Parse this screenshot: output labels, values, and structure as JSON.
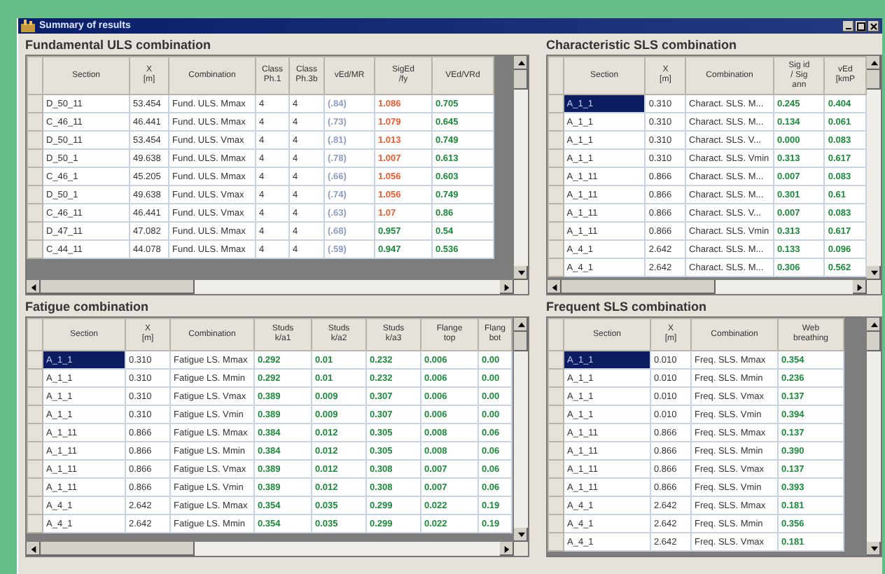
{
  "window": {
    "title": "Summary of results"
  },
  "panels": [
    {
      "title": "Fundamental ULS combination",
      "columns": [
        "Section",
        "X\n[m]",
        "Combination",
        "Class\nPh.1",
        "Class\nPh.3b",
        "vEd/MR",
        "SigEd\n/fy",
        "VEd/VRd"
      ],
      "rows": [
        {
          "selected": false,
          "cells": [
            "D_50_11",
            "53.454",
            "Fund. ULS. Mmax",
            "4",
            "4"
          ],
          "results": [
            {
              "text": "(.84)",
              "color": "#8c9cc4"
            },
            {
              "text": "1.086",
              "color": "#f05a30"
            },
            {
              "text": "0.705",
              "color": "#1a8a3a"
            }
          ]
        },
        {
          "selected": false,
          "cells": [
            "C_46_11",
            "46.441",
            "Fund. ULS. Mmax",
            "4",
            "4"
          ],
          "results": [
            {
              "text": "(.73)",
              "color": "#8c9cc4"
            },
            {
              "text": "1.079",
              "color": "#f05a30"
            },
            {
              "text": "0.645",
              "color": "#1a8a3a"
            }
          ]
        },
        {
          "selected": false,
          "cells": [
            "D_50_11",
            "53.454",
            "Fund. ULS. Vmax",
            "4",
            "4"
          ],
          "results": [
            {
              "text": "(.81)",
              "color": "#8c9cc4"
            },
            {
              "text": "1.013",
              "color": "#f05a30"
            },
            {
              "text": "0.749",
              "color": "#1a8a3a"
            }
          ]
        },
        {
          "selected": false,
          "cells": [
            "D_50_1",
            "49.638",
            "Fund. ULS. Mmax",
            "4",
            "4"
          ],
          "results": [
            {
              "text": "(.78)",
              "color": "#8c9cc4"
            },
            {
              "text": "1.007",
              "color": "#f05a30"
            },
            {
              "text": "0.613",
              "color": "#1a8a3a"
            }
          ]
        },
        {
          "selected": false,
          "cells": [
            "C_46_1",
            "45.205",
            "Fund. ULS. Mmax",
            "4",
            "4"
          ],
          "results": [
            {
              "text": "(.66)",
              "color": "#8c9cc4"
            },
            {
              "text": "1.056",
              "color": "#f05a30"
            },
            {
              "text": "0.603",
              "color": "#1a8a3a"
            }
          ]
        },
        {
          "selected": false,
          "cells": [
            "D_50_1",
            "49.638",
            "Fund. ULS. Vmax",
            "4",
            "4"
          ],
          "results": [
            {
              "text": "(.74)",
              "color": "#8c9cc4"
            },
            {
              "text": "1.056",
              "color": "#f05a30"
            },
            {
              "text": "0.749",
              "color": "#1a8a3a"
            }
          ]
        },
        {
          "selected": false,
          "cells": [
            "C_46_11",
            "46.441",
            "Fund. ULS. Vmax",
            "4",
            "4"
          ],
          "results": [
            {
              "text": "(.63)",
              "color": "#8c9cc4"
            },
            {
              "text": "1.07",
              "color": "#f05a30"
            },
            {
              "text": "0.86",
              "color": "#1a8a3a"
            }
          ]
        },
        {
          "selected": false,
          "cells": [
            "D_47_11",
            "47.082",
            "Fund. ULS. Mmax",
            "4",
            "4"
          ],
          "results": [
            {
              "text": "(.68)",
              "color": "#8c9cc4"
            },
            {
              "text": "0.957",
              "color": "#1a8a3a"
            },
            {
              "text": "0.54",
              "color": "#1a8a3a"
            }
          ]
        },
        {
          "selected": false,
          "cells": [
            "C_44_11",
            "44.078",
            "Fund. ULS. Mmax",
            "4",
            "4"
          ],
          "results": [
            {
              "text": "(.59)",
              "color": "#8c9cc4"
            },
            {
              "text": "0.947",
              "color": "#1a8a3a"
            },
            {
              "text": "0.536",
              "color": "#1a8a3a"
            }
          ]
        }
      ]
    },
    {
      "title": "Characteristic SLS combination",
      "columns": [
        "Section",
        "X\n[m]",
        "Combination",
        "Sig id\n/ Sig\nann",
        "vEd\n[kmP"
      ],
      "rows": [
        {
          "selected": true,
          "cells": [
            "A_1_1",
            "0.310",
            "Charact. SLS. M..."
          ],
          "results": [
            {
              "text": "0.245",
              "color": "#1a8a3a"
            },
            {
              "text": "0.404",
              "color": "#1a8a3a"
            }
          ]
        },
        {
          "selected": false,
          "cells": [
            "A_1_1",
            "0.310",
            "Charact. SLS. M..."
          ],
          "results": [
            {
              "text": "0.134",
              "color": "#1a8a3a"
            },
            {
              "text": "0.061",
              "color": "#1a8a3a"
            }
          ]
        },
        {
          "selected": false,
          "cells": [
            "A_1_1",
            "0.310",
            "Charact. SLS. V..."
          ],
          "results": [
            {
              "text": "0.000",
              "color": "#1a8a3a"
            },
            {
              "text": "0.083",
              "color": "#1a8a3a"
            }
          ]
        },
        {
          "selected": false,
          "cells": [
            "A_1_1",
            "0.310",
            "Charact. SLS. Vmin"
          ],
          "results": [
            {
              "text": "0.313",
              "color": "#1a8a3a"
            },
            {
              "text": "0.617",
              "color": "#1a8a3a"
            }
          ]
        },
        {
          "selected": false,
          "cells": [
            "A_1_11",
            "0.866",
            "Charact. SLS. M..."
          ],
          "results": [
            {
              "text": "0.007",
              "color": "#1a8a3a"
            },
            {
              "text": "0.083",
              "color": "#1a8a3a"
            }
          ]
        },
        {
          "selected": false,
          "cells": [
            "A_1_11",
            "0.866",
            "Charact. SLS. M..."
          ],
          "results": [
            {
              "text": "0.301",
              "color": "#1a8a3a"
            },
            {
              "text": "0.61",
              "color": "#1a8a3a"
            }
          ]
        },
        {
          "selected": false,
          "cells": [
            "A_1_11",
            "0.866",
            "Charact. SLS. V..."
          ],
          "results": [
            {
              "text": "0.007",
              "color": "#1a8a3a"
            },
            {
              "text": "0.083",
              "color": "#1a8a3a"
            }
          ]
        },
        {
          "selected": false,
          "cells": [
            "A_1_11",
            "0.866",
            "Charact. SLS. Vmin"
          ],
          "results": [
            {
              "text": "0.313",
              "color": "#1a8a3a"
            },
            {
              "text": "0.617",
              "color": "#1a8a3a"
            }
          ]
        },
        {
          "selected": false,
          "cells": [
            "A_4_1",
            "2.642",
            "Charact. SLS. M..."
          ],
          "results": [
            {
              "text": "0.133",
              "color": "#1a8a3a"
            },
            {
              "text": "0.096",
              "color": "#1a8a3a"
            }
          ]
        },
        {
          "selected": false,
          "cells": [
            "A_4_1",
            "2.642",
            "Charact. SLS. M..."
          ],
          "results": [
            {
              "text": "0.306",
              "color": "#1a8a3a"
            },
            {
              "text": "0.562",
              "color": "#1a8a3a"
            }
          ]
        }
      ]
    },
    {
      "title": "Fatigue combination",
      "columns": [
        "Section",
        "X\n[m]",
        "Combination",
        "Studs\nk/a1",
        "Studs\nk/a2",
        "Studs\nk/a3",
        "Flange\ntop",
        "Flang\nbot"
      ],
      "rows": [
        {
          "selected": true,
          "cells": [
            "A_1_1",
            "0.310",
            "Fatigue LS. Mmax"
          ],
          "results": [
            {
              "text": "0.292",
              "color": "#1a8a3a"
            },
            {
              "text": "0.01",
              "color": "#1a8a3a"
            },
            {
              "text": "0.232",
              "color": "#1a8a3a"
            },
            {
              "text": "0.006",
              "color": "#1a8a3a"
            },
            {
              "text": "0.00",
              "color": "#1a8a3a"
            }
          ]
        },
        {
          "selected": false,
          "cells": [
            "A_1_1",
            "0.310",
            "Fatigue LS. Mmin"
          ],
          "results": [
            {
              "text": "0.292",
              "color": "#1a8a3a"
            },
            {
              "text": "0.01",
              "color": "#1a8a3a"
            },
            {
              "text": "0.232",
              "color": "#1a8a3a"
            },
            {
              "text": "0.006",
              "color": "#1a8a3a"
            },
            {
              "text": "0.00",
              "color": "#1a8a3a"
            }
          ]
        },
        {
          "selected": false,
          "cells": [
            "A_1_1",
            "0.310",
            "Fatigue LS. Vmax"
          ],
          "results": [
            {
              "text": "0.389",
              "color": "#1a8a3a"
            },
            {
              "text": "0.009",
              "color": "#1a8a3a"
            },
            {
              "text": "0.307",
              "color": "#1a8a3a"
            },
            {
              "text": "0.006",
              "color": "#1a8a3a"
            },
            {
              "text": "0.00",
              "color": "#1a8a3a"
            }
          ]
        },
        {
          "selected": false,
          "cells": [
            "A_1_1",
            "0.310",
            "Fatigue LS. Vmin"
          ],
          "results": [
            {
              "text": "0.389",
              "color": "#1a8a3a"
            },
            {
              "text": "0.009",
              "color": "#1a8a3a"
            },
            {
              "text": "0.307",
              "color": "#1a8a3a"
            },
            {
              "text": "0.006",
              "color": "#1a8a3a"
            },
            {
              "text": "0.00",
              "color": "#1a8a3a"
            }
          ]
        },
        {
          "selected": false,
          "cells": [
            "A_1_11",
            "0.866",
            "Fatigue LS. Mmax"
          ],
          "results": [
            {
              "text": "0.384",
              "color": "#1a8a3a"
            },
            {
              "text": "0.012",
              "color": "#1a8a3a"
            },
            {
              "text": "0.305",
              "color": "#1a8a3a"
            },
            {
              "text": "0.008",
              "color": "#1a8a3a"
            },
            {
              "text": "0.06",
              "color": "#1a8a3a"
            }
          ]
        },
        {
          "selected": false,
          "cells": [
            "A_1_11",
            "0.866",
            "Fatigue LS. Mmin"
          ],
          "results": [
            {
              "text": "0.384",
              "color": "#1a8a3a"
            },
            {
              "text": "0.012",
              "color": "#1a8a3a"
            },
            {
              "text": "0.305",
              "color": "#1a8a3a"
            },
            {
              "text": "0.008",
              "color": "#1a8a3a"
            },
            {
              "text": "0.06",
              "color": "#1a8a3a"
            }
          ]
        },
        {
          "selected": false,
          "cells": [
            "A_1_11",
            "0.866",
            "Fatigue LS. Vmax"
          ],
          "results": [
            {
              "text": "0.389",
              "color": "#1a8a3a"
            },
            {
              "text": "0.012",
              "color": "#1a8a3a"
            },
            {
              "text": "0.308",
              "color": "#1a8a3a"
            },
            {
              "text": "0.007",
              "color": "#1a8a3a"
            },
            {
              "text": "0.06",
              "color": "#1a8a3a"
            }
          ]
        },
        {
          "selected": false,
          "cells": [
            "A_1_11",
            "0.866",
            "Fatigue LS. Vmin"
          ],
          "results": [
            {
              "text": "0.389",
              "color": "#1a8a3a"
            },
            {
              "text": "0.012",
              "color": "#1a8a3a"
            },
            {
              "text": "0.308",
              "color": "#1a8a3a"
            },
            {
              "text": "0.007",
              "color": "#1a8a3a"
            },
            {
              "text": "0.06",
              "color": "#1a8a3a"
            }
          ]
        },
        {
          "selected": false,
          "cells": [
            "A_4_1",
            "2.642",
            "Fatigue LS. Mmax"
          ],
          "results": [
            {
              "text": "0.354",
              "color": "#1a8a3a"
            },
            {
              "text": "0.035",
              "color": "#1a8a3a"
            },
            {
              "text": "0.299",
              "color": "#1a8a3a"
            },
            {
              "text": "0.022",
              "color": "#1a8a3a"
            },
            {
              "text": "0.19",
              "color": "#1a8a3a"
            }
          ]
        },
        {
          "selected": false,
          "cells": [
            "A_4_1",
            "2.642",
            "Fatigue LS. Mmin"
          ],
          "results": [
            {
              "text": "0.354",
              "color": "#1a8a3a"
            },
            {
              "text": "0.035",
              "color": "#1a8a3a"
            },
            {
              "text": "0.299",
              "color": "#1a8a3a"
            },
            {
              "text": "0.022",
              "color": "#1a8a3a"
            },
            {
              "text": "0.19",
              "color": "#1a8a3a"
            }
          ]
        }
      ]
    },
    {
      "title": "Frequent SLS combination",
      "columns": [
        "Section",
        "X\n[m]",
        "Combination",
        "Web\nbreathing"
      ],
      "rows": [
        {
          "selected": true,
          "cells": [
            "A_1_1",
            "0.010",
            "Freq. SLS. Mmax"
          ],
          "results": [
            {
              "text": "0.354",
              "color": "#1a8a3a"
            }
          ]
        },
        {
          "selected": false,
          "cells": [
            "A_1_1",
            "0.010",
            "Freq. SLS. Mmin"
          ],
          "results": [
            {
              "text": "0.236",
              "color": "#1a8a3a"
            }
          ]
        },
        {
          "selected": false,
          "cells": [
            "A_1_1",
            "0.010",
            "Freq. SLS. Vmax"
          ],
          "results": [
            {
              "text": "0.137",
              "color": "#1a8a3a"
            }
          ]
        },
        {
          "selected": false,
          "cells": [
            "A_1_1",
            "0.010",
            "Freq. SLS. Vmin"
          ],
          "results": [
            {
              "text": "0.394",
              "color": "#1a8a3a"
            }
          ]
        },
        {
          "selected": false,
          "cells": [
            "A_1_11",
            "0.866",
            "Freq. SLS. Mmax"
          ],
          "results": [
            {
              "text": "0.137",
              "color": "#1a8a3a"
            }
          ]
        },
        {
          "selected": false,
          "cells": [
            "A_1_11",
            "0.866",
            "Freq. SLS. Mmin"
          ],
          "results": [
            {
              "text": "0.390",
              "color": "#1a8a3a"
            }
          ]
        },
        {
          "selected": false,
          "cells": [
            "A_1_11",
            "0.866",
            "Freq. SLS. Vmax"
          ],
          "results": [
            {
              "text": "0.137",
              "color": "#1a8a3a"
            }
          ]
        },
        {
          "selected": false,
          "cells": [
            "A_1_11",
            "0.866",
            "Freq. SLS. Vmin"
          ],
          "results": [
            {
              "text": "0.393",
              "color": "#1a8a3a"
            }
          ]
        },
        {
          "selected": false,
          "cells": [
            "A_4_1",
            "2.642",
            "Freq. SLS. Mmax"
          ],
          "results": [
            {
              "text": "0.181",
              "color": "#1a8a3a"
            }
          ]
        },
        {
          "selected": false,
          "cells": [
            "A_4_1",
            "2.642",
            "Freq. SLS. Mmin"
          ],
          "results": [
            {
              "text": "0.356",
              "color": "#1a8a3a"
            }
          ]
        },
        {
          "selected": false,
          "cells": [
            "A_4_1",
            "2.642",
            "Freq. SLS. Vmax"
          ],
          "results": [
            {
              "text": "0.181",
              "color": "#1a8a3a"
            }
          ]
        }
      ]
    }
  ]
}
